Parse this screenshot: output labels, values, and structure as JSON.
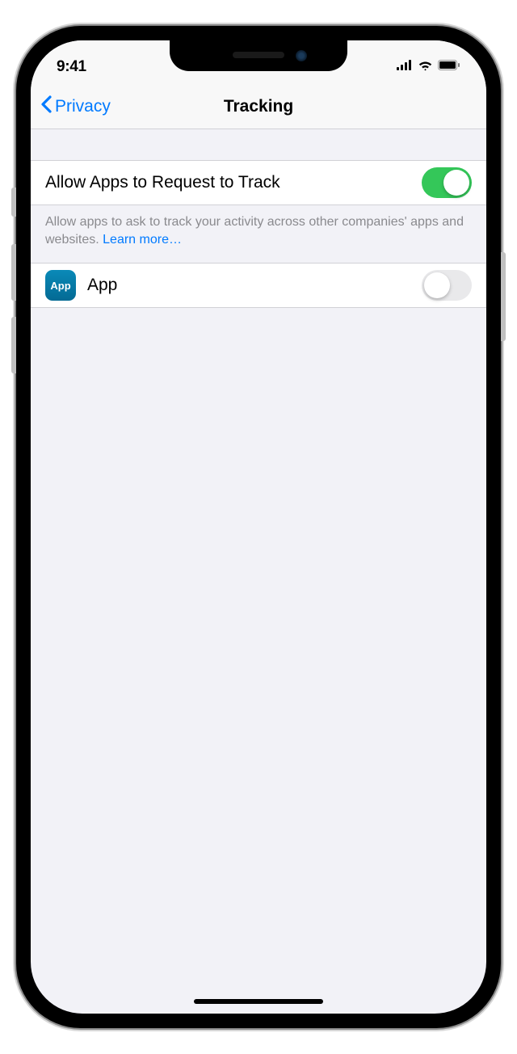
{
  "status": {
    "time": "9:41"
  },
  "nav": {
    "back_label": "Privacy",
    "title": "Tracking"
  },
  "allow_tracking": {
    "label": "Allow Apps to Request to Track",
    "enabled": true
  },
  "footer": {
    "text": "Allow apps to ask to track your activity across other companies' apps and websites. ",
    "link": "Learn more…"
  },
  "app": {
    "icon_text": "App",
    "name": "App",
    "enabled": false
  }
}
